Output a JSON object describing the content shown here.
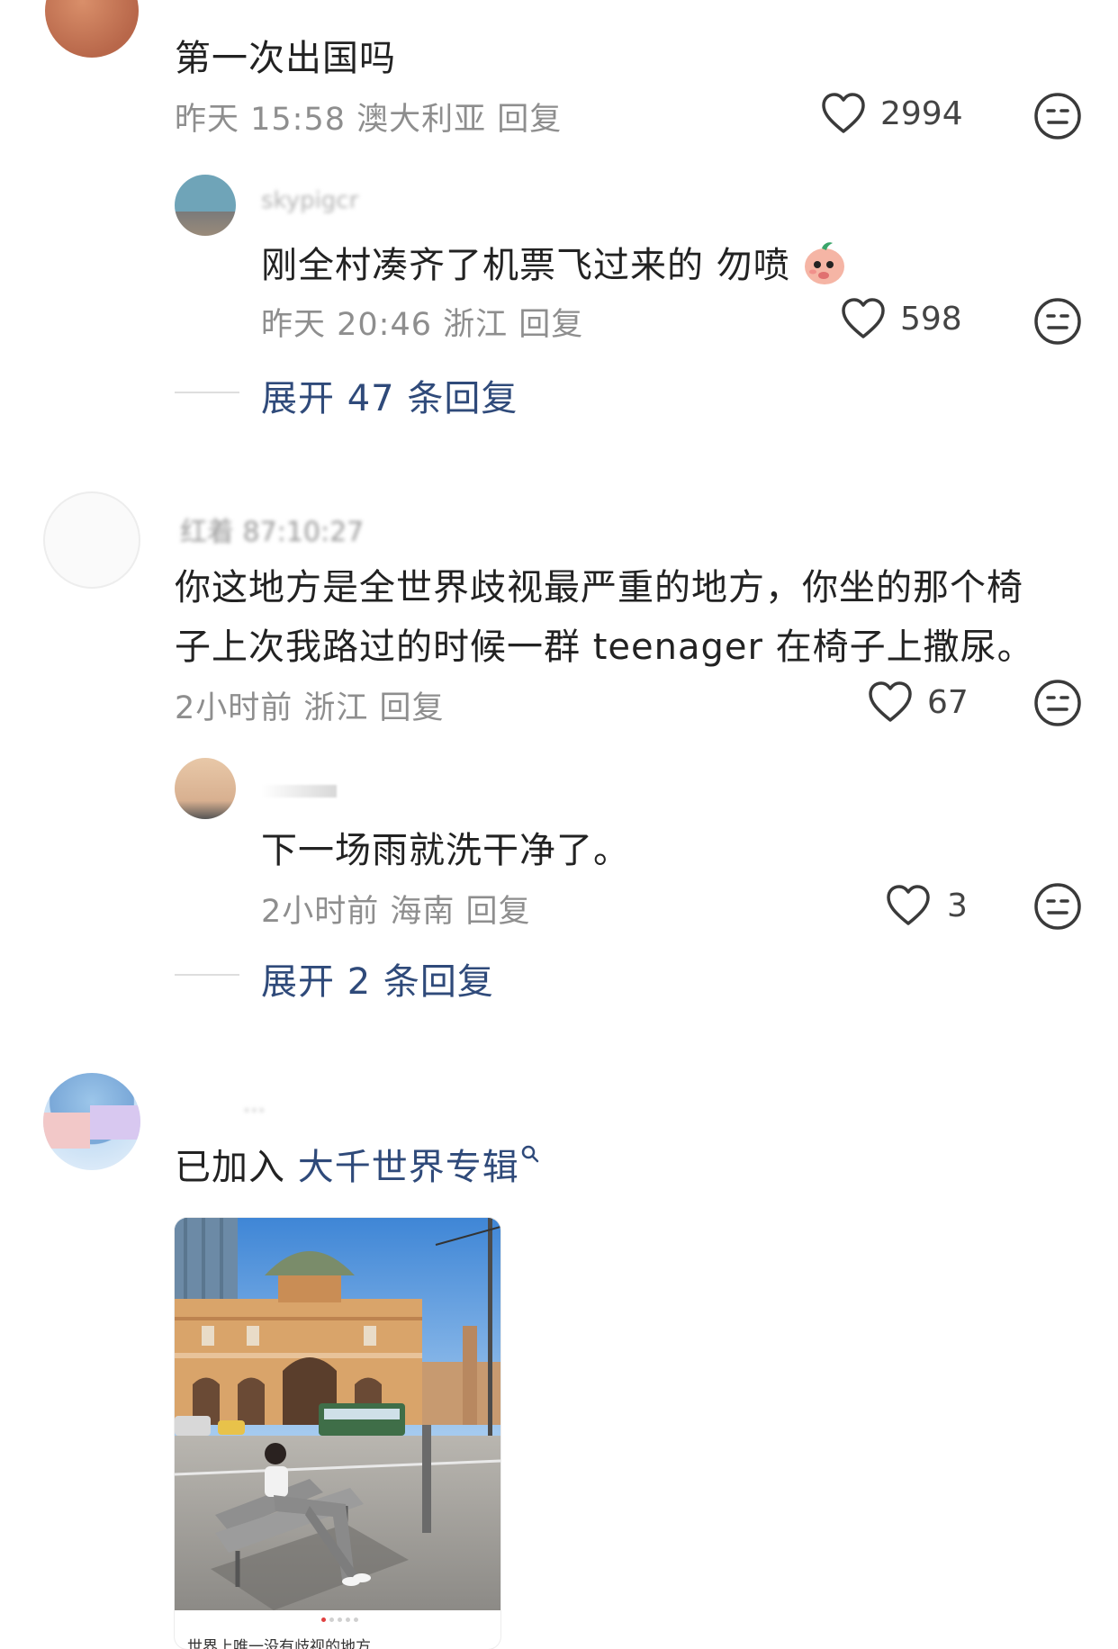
{
  "comments": [
    {
      "text": "第一次出国吗",
      "meta": "昨天 15:58 澳大利亚 回复",
      "likes": "2994"
    },
    {
      "username": "skypigcr",
      "text": "刚全村凑齐了机票飞过来的 勿喷",
      "meta": "昨天 20:46 浙江 回复",
      "likes": "598",
      "emoji_icon": "peach-emoji-icon"
    },
    {
      "expand_label": "展开 47 条回复"
    },
    {
      "username": "红着 87:10:27",
      "text_line1": "你这地方是全世界歧视最严重的地方，你坐的那个椅",
      "text_line2": "子上次我路过的时候一群 teenager 在椅子上撒尿。",
      "meta": "2小时前 浙江 回复",
      "likes": "67"
    },
    {
      "text": "下一场雨就洗干净了。",
      "meta": "2小时前 海南 回复",
      "likes": "3"
    },
    {
      "expand_label": "展开 2 条回复"
    },
    {
      "username": "...",
      "prefix": "已加入 ",
      "album_link": "大千世界专辑",
      "card_caption": "世界上唯一没有歧视的地方"
    }
  ],
  "icons": {
    "like": "heart-outline-icon",
    "dislike": "meh-face-icon",
    "search": "search-icon"
  },
  "colors": {
    "link": "#2f4a7a",
    "meta": "#8e8e8e"
  }
}
